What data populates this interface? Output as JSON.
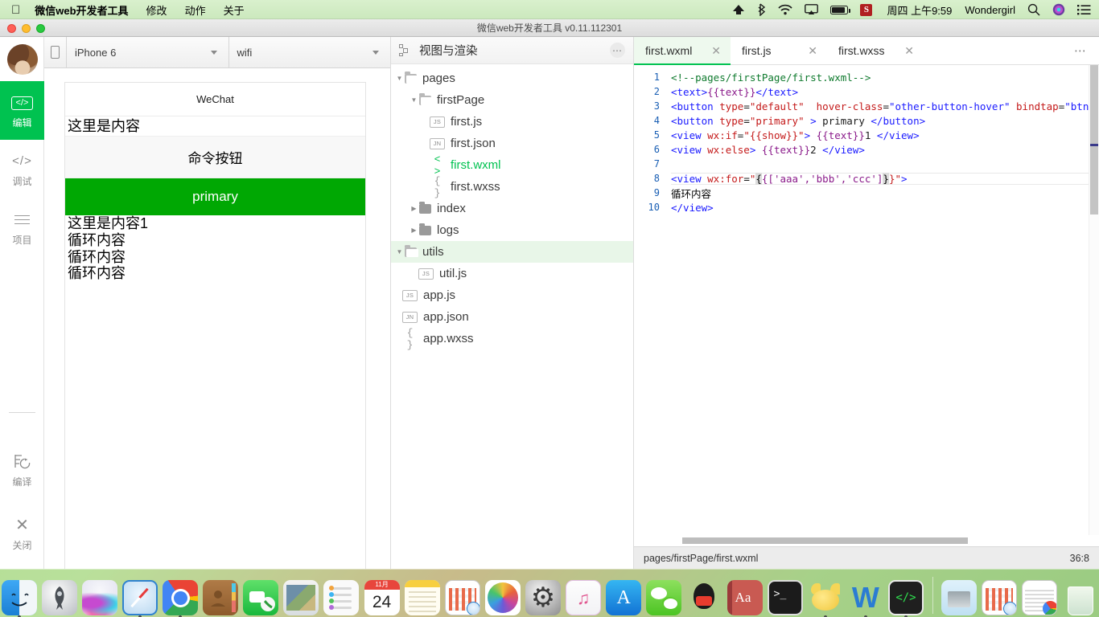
{
  "menubar": {
    "apple_icon": "apple-logo-icon",
    "items": [
      {
        "label": "微信web开发者工具",
        "bold": true
      },
      {
        "label": "修改",
        "bold": false
      },
      {
        "label": "动作",
        "bold": false
      },
      {
        "label": "关于",
        "bold": false
      }
    ],
    "status_icons": [
      "airdrop-icon",
      "bluetooth-icon",
      "wifi-icon",
      "airplay-icon",
      "battery-icon",
      "sogou-input-icon"
    ],
    "sogou_label": "S",
    "clock": "周四 上午9:59",
    "user": "Wondergirl",
    "right_icons": [
      "search-icon",
      "siri-icon",
      "notification-center-icon"
    ]
  },
  "window": {
    "title": "微信web开发者工具 v0.11.112301"
  },
  "rail": {
    "items": [
      {
        "label": "编辑",
        "icon": "code-brackets-icon",
        "active": true
      },
      {
        "label": "调试",
        "icon": "code-brackets-icon",
        "active": false
      },
      {
        "label": "项目",
        "icon": "list-lines-icon",
        "active": false
      }
    ],
    "lower_items": [
      {
        "label": "编译",
        "icon": "compile-refresh-icon"
      },
      {
        "label": "关闭",
        "icon": "close-x-icon"
      }
    ]
  },
  "simulator": {
    "rotate_icon": "rotate-device-icon",
    "device": "iPhone 6",
    "network": "wifi",
    "phone": {
      "navbar_title": "WeChat",
      "text_node": "这里是内容",
      "default_button": "命令按钮",
      "primary_button": "primary",
      "view_if_text": "这里是内容1",
      "loop_items": [
        "循环内容",
        "循环内容",
        "循环内容"
      ]
    }
  },
  "tree": {
    "header_title": "视图与渲染",
    "header_icon": "structure-icon",
    "more_icon": "more-dots-icon",
    "nodes": [
      {
        "label": "pages",
        "kind": "folder",
        "open": true,
        "depth": 0,
        "selected": false
      },
      {
        "label": "firstPage",
        "kind": "folder",
        "open": true,
        "depth": 1,
        "selected": false
      },
      {
        "label": "first.js",
        "kind": "js",
        "depth": 2,
        "selected": false
      },
      {
        "label": "first.json",
        "kind": "jn",
        "depth": 2,
        "selected": false
      },
      {
        "label": "first.wxml",
        "kind": "wxml",
        "depth": 2,
        "selected": false,
        "active_file": true
      },
      {
        "label": "first.wxss",
        "kind": "wxss",
        "depth": 2,
        "selected": false
      },
      {
        "label": "index",
        "kind": "folder",
        "open": false,
        "depth": 1,
        "selected": false
      },
      {
        "label": "logs",
        "kind": "folder",
        "open": false,
        "depth": 1,
        "selected": false
      },
      {
        "label": "utils",
        "kind": "folder",
        "open": true,
        "depth": 0,
        "selected": true
      },
      {
        "label": "util.js",
        "kind": "js",
        "depth": 1,
        "selected": false
      },
      {
        "label": "app.js",
        "kind": "js",
        "depth": 0,
        "selected": false
      },
      {
        "label": "app.json",
        "kind": "jn",
        "depth": 0,
        "selected": false
      },
      {
        "label": "app.wxss",
        "kind": "wxss",
        "depth": 0,
        "selected": false
      }
    ],
    "badge_js": "JS",
    "badge_jn": "JN",
    "glyph_wxml": "< >",
    "glyph_wxss": "{ }"
  },
  "editor": {
    "tabs": [
      {
        "label": "first.wxml",
        "active": true,
        "close_icon": "close-icon"
      },
      {
        "label": "first.js",
        "active": false,
        "close_icon": "close-icon"
      },
      {
        "label": "first.wxss",
        "active": false,
        "close_icon": "close-icon"
      }
    ],
    "more_icon": "more-dots-icon",
    "lines": [
      {
        "n": "1",
        "text": "<!--pages/firstPage/first.wxml-->"
      },
      {
        "n": "2",
        "text": "<text>{{text}}</text>"
      },
      {
        "n": "3",
        "text": "<button type=\"default\"  hover-class=\"other-button-hover\" bindtap=\"btnCl"
      },
      {
        "n": "4",
        "text": "<button type=\"primary\" > primary </button>"
      },
      {
        "n": "5",
        "text": "<view wx:if=\"{{show}}\"> {{text}}1 </view>"
      },
      {
        "n": "6",
        "text": "<view wx:else> {{text}}2 </view>"
      },
      {
        "n": "7",
        "text": ""
      },
      {
        "n": "8",
        "text": "<view wx:for=\"{{['aaa','bbb','ccc']}}\">"
      },
      {
        "n": "9",
        "text": "循环内容"
      },
      {
        "n": "10",
        "text": "</view>"
      }
    ],
    "status_path": "pages/firstPage/first.wxml",
    "status_position": "36:8"
  },
  "dock": {
    "items": [
      {
        "name": "finder",
        "label": "Finder",
        "cls": "i-finder",
        "running": true
      },
      {
        "name": "launchpad",
        "label": "Launchpad",
        "cls": "i-launch",
        "running": false
      },
      {
        "name": "siri",
        "label": "Siri",
        "cls": "i-siri",
        "running": false
      },
      {
        "name": "safari",
        "label": "Safari",
        "cls": "i-safari",
        "running": true
      },
      {
        "name": "chrome",
        "label": "Google Chrome",
        "cls": "i-chrome",
        "running": true
      },
      {
        "name": "contacts",
        "label": "Contacts",
        "cls": "i-contacts",
        "running": false
      },
      {
        "name": "facetime",
        "label": "FaceTime",
        "cls": "i-facetime",
        "running": false
      },
      {
        "name": "mail",
        "label": "Mail",
        "cls": "i-mail",
        "running": false
      },
      {
        "name": "reminders",
        "label": "Reminders",
        "cls": "i-reminders",
        "running": false
      },
      {
        "name": "calendar",
        "label": "Calendar",
        "cls": "i-cal",
        "running": false
      },
      {
        "name": "notes",
        "label": "Notes",
        "cls": "i-notes",
        "running": false
      },
      {
        "name": "news",
        "label": "News",
        "cls": "i-win1",
        "running": false
      },
      {
        "name": "photos",
        "label": "Photos",
        "cls": "i-photos",
        "running": false
      },
      {
        "name": "system-prefs",
        "label": "System Preferences",
        "cls": "i-prefs",
        "running": false
      },
      {
        "name": "itunes",
        "label": "iTunes",
        "cls": "i-itunes",
        "running": false
      },
      {
        "name": "app-store",
        "label": "App Store",
        "cls": "i-appstore",
        "running": false
      },
      {
        "name": "wechat",
        "label": "WeChat",
        "cls": "i-wechat",
        "running": false
      },
      {
        "name": "qq",
        "label": "QQ",
        "cls": "i-qq",
        "running": false
      },
      {
        "name": "dictionary",
        "label": "Dictionary",
        "cls": "i-dict",
        "running": false
      },
      {
        "name": "terminal",
        "label": "Terminal",
        "cls": "i-term",
        "running": false
      },
      {
        "name": "foxmail",
        "label": "Foxmail",
        "cls": "i-foxmail",
        "running": true
      },
      {
        "name": "word",
        "label": "Microsoft Word",
        "cls": "i-word",
        "running": true
      },
      {
        "name": "wechat-devtools",
        "label": "微信web开发者工具",
        "cls": "i-wxdev",
        "running": true
      }
    ],
    "recent": [
      {
        "name": "document-file",
        "label": "Document",
        "cls": "i-doc"
      },
      {
        "name": "window-preview-1",
        "label": "Window",
        "cls": "i-win1"
      },
      {
        "name": "window-preview-2",
        "label": "Window",
        "cls": "i-win2"
      }
    ],
    "trash": {
      "name": "trash",
      "label": "Trash",
      "cls": "i-trash"
    },
    "calendar_month": "11月",
    "calendar_day": "24"
  },
  "colors": {
    "accent_green": "#00c250",
    "primary_button": "#00a803",
    "selection_green": "#e8f6e8",
    "menubar": "#cbe8bd"
  }
}
